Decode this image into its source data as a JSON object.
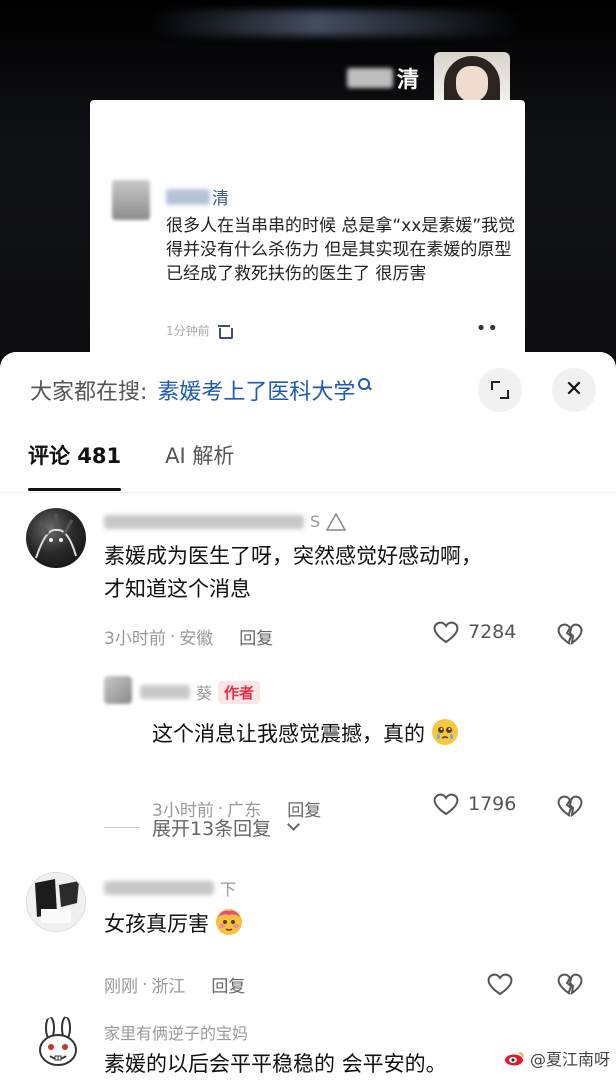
{
  "header": {
    "name_suffix": "清"
  },
  "post": {
    "name_suffix": "清",
    "text": "很多人在当串串的时候 总是拿“xx是素媛”我觉得并没有什么杀伤力 但是其实现在素媛的原型已经成了救死扶伤的医生了 很厉害",
    "time": "1分钟前",
    "more": "••"
  },
  "search": {
    "label": "大家都在搜:",
    "term": "素媛考上了医科大学"
  },
  "tabs": {
    "comments_label": "评论 481",
    "ai_label": "AI 解析"
  },
  "comments": [
    {
      "name_suffix": "S",
      "text_line1": "素媛成为医生了呀，突然感觉好感动啊，",
      "text_line2": "才知道这个消息",
      "time": "3小时前",
      "location": "安徽",
      "reply": "回复",
      "likes": "7284"
    },
    {
      "name_suffix": "葵",
      "author_tag": "作者",
      "text": "这个消息让我感觉震撼，真的",
      "time": "3小时前",
      "location": "广东",
      "reply": "回复",
      "likes": "1796"
    },
    {
      "name_suffix": "下",
      "text": "女孩真厉害",
      "time": "刚刚",
      "location": "浙江",
      "reply": "回复"
    },
    {
      "name": "家里有俩逆子的宝妈",
      "text": "素媛的以后会平平稳稳的 会平安的。"
    }
  ],
  "expand_replies": "展开13条回复",
  "watermark": "@夏江南呀",
  "colors": {
    "link_blue": "#1d5ab5",
    "author_red": "#e6304a",
    "text_gray": "#999999"
  }
}
